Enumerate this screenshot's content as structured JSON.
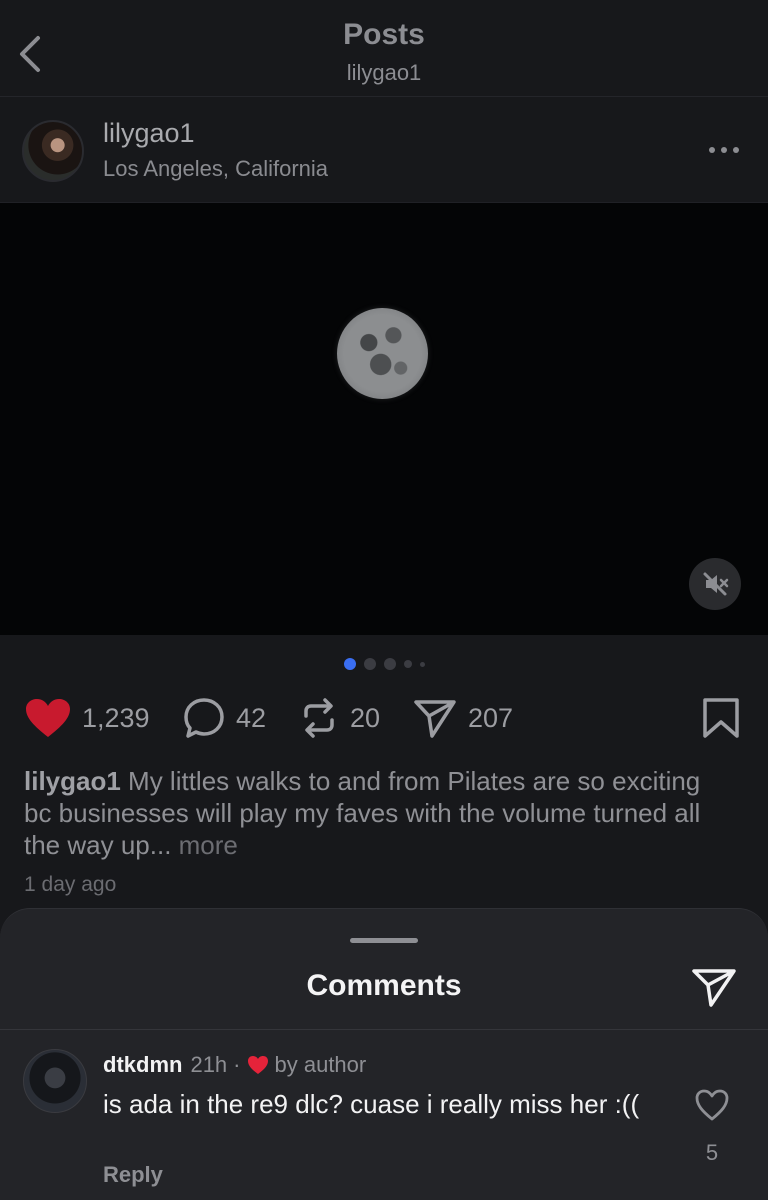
{
  "header": {
    "title": "Posts",
    "subtitle": "lilygao1"
  },
  "post": {
    "username": "lilygao1",
    "location": "Los Angeles, California",
    "media": {
      "carousel_count": 5,
      "carousel_active_index": 0
    },
    "actions": {
      "likes": "1,239",
      "comments": "42",
      "reposts": "20",
      "shares": "207"
    },
    "caption_user": "lilygao1",
    "caption_text": " My littles walks to and from Pilates are so exciting bc businesses will play my faves with the volume turned all the way up...",
    "caption_more": " more",
    "timestamp": "1 day ago"
  },
  "comments_sheet": {
    "title": "Comments",
    "comments": [
      {
        "username": "dtkdmn",
        "time": "21h",
        "separator": "·",
        "badge": "by author",
        "text": "is ada in the re9 dlc? cuase i really miss her :((",
        "reply_label": "Reply",
        "like_count": "5"
      }
    ]
  },
  "colors": {
    "like_red": "#e5233a",
    "active_dot_blue": "#3a6ef2",
    "background": "#17181b",
    "sheet": "#232428"
  },
  "icons": [
    "back-chevron-icon",
    "more-dots-icon",
    "mute-icon",
    "heart-icon",
    "comment-bubble-icon",
    "repost-icon",
    "share-icon",
    "bookmark-icon",
    "send-icon"
  ]
}
